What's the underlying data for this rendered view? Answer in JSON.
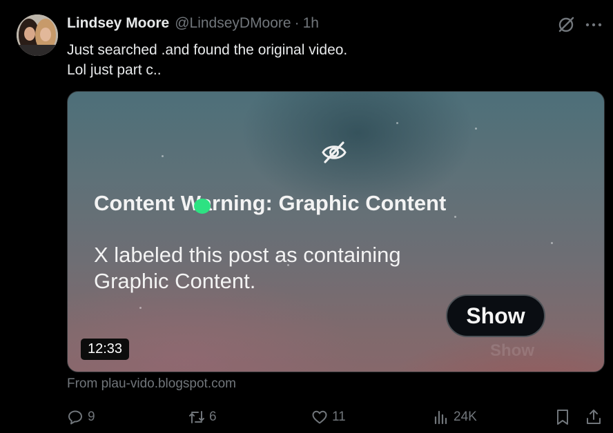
{
  "tweet": {
    "author_name": "Lindsey Moore",
    "author_handle": "@LindseyDMoore",
    "separator": "·",
    "time": "1h",
    "text_line1": "Just searched .and found the original video.",
    "text_line2": "Lol just part c.."
  },
  "media": {
    "warning_title_part1": "Content W",
    "warning_title_part2": "arning: Graphic Content",
    "warning_text": "X labeled this post as containing Graphic Content.",
    "show_label": "Show",
    "ghost_show_label": "Show",
    "duration": "12:33"
  },
  "source": "From plau-vido.blogspot.com",
  "actions": {
    "replies": "9",
    "reposts": "6",
    "likes": "11",
    "views": "24K"
  },
  "icons": [
    "grok-icon",
    "more-icon",
    "eye-off-icon",
    "reply-icon",
    "repost-icon",
    "like-icon",
    "views-icon",
    "bookmark-icon",
    "share-icon"
  ],
  "colors": {
    "background": "#000000",
    "muted": "#71767b",
    "text": "#e7e9ea",
    "highlight_dot": "#2de282"
  }
}
